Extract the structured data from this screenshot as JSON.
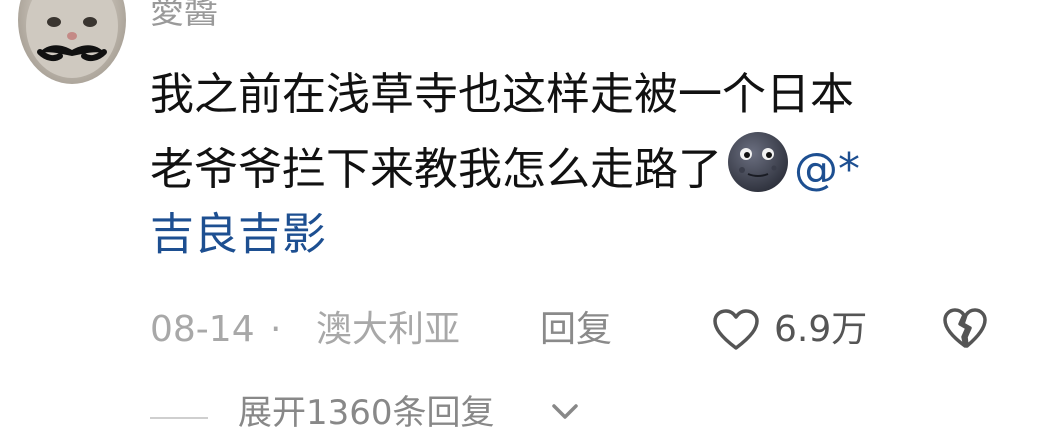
{
  "comment": {
    "username": "愛醬",
    "avatar": "cat-with-mustache-avatar",
    "text_line1": "我之前在浅草寺也这样走被一个日本",
    "text_line2": "老爷爷拦下来教我怎么走路了",
    "emoji": "new-moon-face-emoji",
    "mention_line2": "@*",
    "mention_line3": "吉良吉影",
    "date": "08-14",
    "separator": "·",
    "location": "澳大利亚",
    "reply_label": "回复",
    "likes": "6.9万",
    "like_icon": "heart-outline-icon",
    "dislike_icon": "broken-heart-icon"
  },
  "replies": {
    "expand_label": "展开1360条回复",
    "expand_icon": "chevron-down-icon"
  },
  "colors": {
    "text": "#111111",
    "mention": "#1d4f91",
    "meta": "#a8a8a8"
  }
}
